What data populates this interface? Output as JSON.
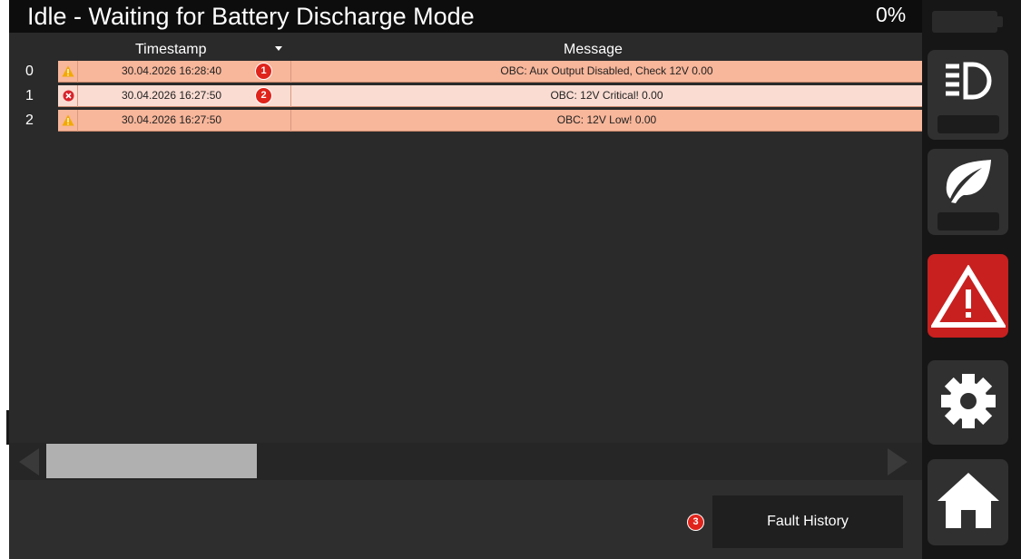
{
  "header": {
    "status_title": "Idle - Waiting for Battery Discharge Mode",
    "battery_percent": "0%"
  },
  "table": {
    "columns": {
      "timestamp": "Timestamp",
      "message": "Message"
    },
    "rows": [
      {
        "index": "0",
        "severity": "warning",
        "timestamp": "30.04.2026 16:28:40",
        "message": "OBC: Aux Output Disabled, Check 12V 0.00",
        "callout": "1"
      },
      {
        "index": "1",
        "severity": "critical",
        "timestamp": "30.04.2026 16:27:50",
        "message": "OBC: 12V Critical! 0.00",
        "callout": "2"
      },
      {
        "index": "2",
        "severity": "warning",
        "timestamp": "30.04.2026 16:27:50",
        "message": "OBC: 12V Low! 0.00"
      }
    ]
  },
  "footer": {
    "fault_history_label": "Fault History",
    "fault_history_callout": "3"
  },
  "nav": {
    "items": [
      {
        "name": "lights",
        "icon": "headlight-icon",
        "active": false
      },
      {
        "name": "eco",
        "icon": "leaf-icon",
        "active": false
      },
      {
        "name": "faults",
        "icon": "warning-triangle-icon",
        "active": true
      },
      {
        "name": "settings",
        "icon": "gear-icon",
        "active": false
      },
      {
        "name": "home",
        "icon": "home-icon",
        "active": false
      }
    ]
  },
  "colors": {
    "warning_row": "#f8b69a",
    "critical_row": "#fbdcd2",
    "active_nav": "#c8201f",
    "callout": "#e0241b"
  }
}
